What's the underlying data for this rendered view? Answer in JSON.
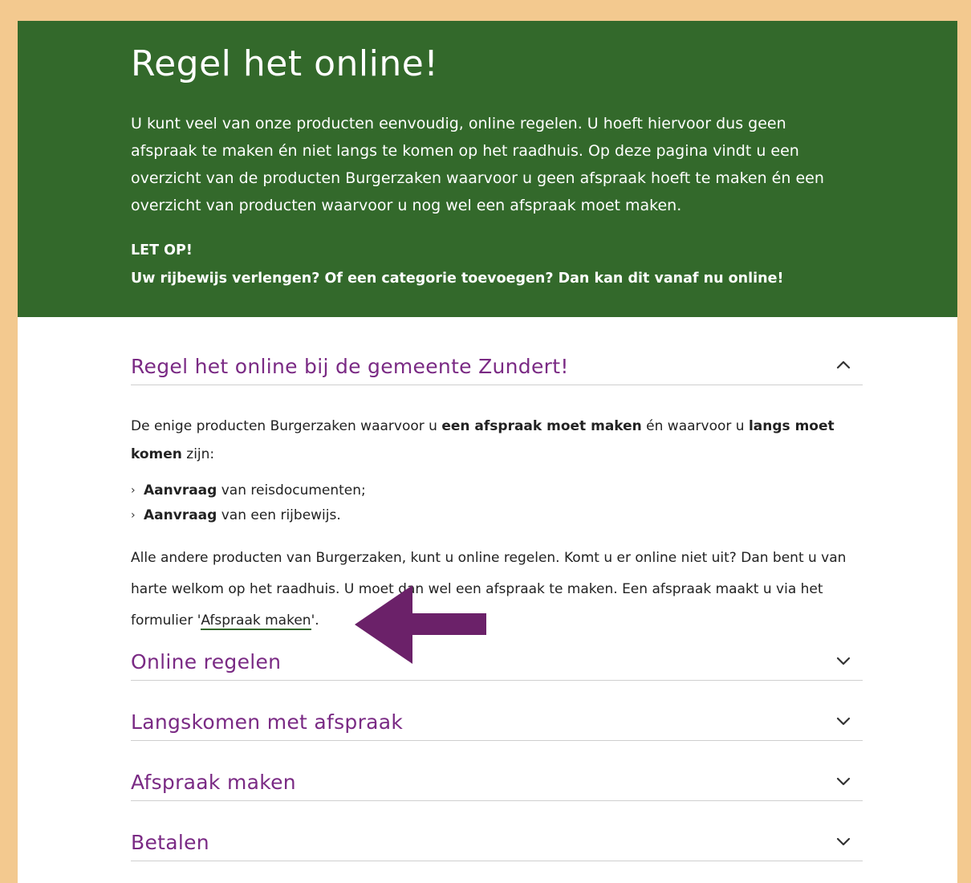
{
  "hero": {
    "title": "Regel het online!",
    "intro": "U kunt veel van onze producten eenvoudig, online regelen. U hoeft hiervoor dus geen afspraak te maken én niet langs te komen op het raadhuis. Op deze pagina vindt u een overzicht van de producten Burgerzaken waarvoor u geen afspraak hoeft te maken én een overzicht van producten waarvoor u nog wel een afspraak moet maken.",
    "note_title": "LET OP!",
    "note_text": "Uw rijbewijs verlengen? Of een categorie toevoegen? Dan kan dit vanaf nu online!"
  },
  "accordion": {
    "open_section": {
      "title": "Regel het online bij de gemeente Zundert!",
      "state": "expanded",
      "p1": {
        "t1": "De enige producten Burgerzaken waarvoor u ",
        "b1": "een afspraak moet maken",
        "t2": " én waarvoor u ",
        "b2": "langs moet komen",
        "t3": " zijn:"
      },
      "bullets": [
        {
          "bold": "Aanvraag",
          "text": " van reisdocumenten;"
        },
        {
          "bold": "Aanvraag",
          "text": " van een rijbewijs."
        }
      ],
      "p2": {
        "text": "Alle andere producten van Burgerzaken, kunt u online regelen. Komt u er online niet uit? Dan bent u van harte welkom op het raadhuis. U moet dan wel een afspraak te maken. Een afspraak maakt u via het formulier '",
        "link": "Afspraak maken",
        "after": "'."
      }
    },
    "collapsed_sections": [
      {
        "title": "Online regelen",
        "state": "collapsed"
      },
      {
        "title": "Langskomen met afspraak",
        "state": "collapsed"
      },
      {
        "title": "Afspraak maken",
        "state": "collapsed"
      },
      {
        "title": "Betalen",
        "state": "collapsed"
      }
    ]
  },
  "icons": {
    "chevron_up": "chevron-up-icon",
    "chevron_down": "chevron-down-icon",
    "bullet": "chevron-right-icon",
    "annotation": "arrow-left-annotation"
  },
  "colors": {
    "page_border": "#f3c98f",
    "hero_bg": "#33692b",
    "heading_purple": "#7a2a84",
    "arrow_purple": "#6b2169",
    "link_underline": "#33692b"
  }
}
